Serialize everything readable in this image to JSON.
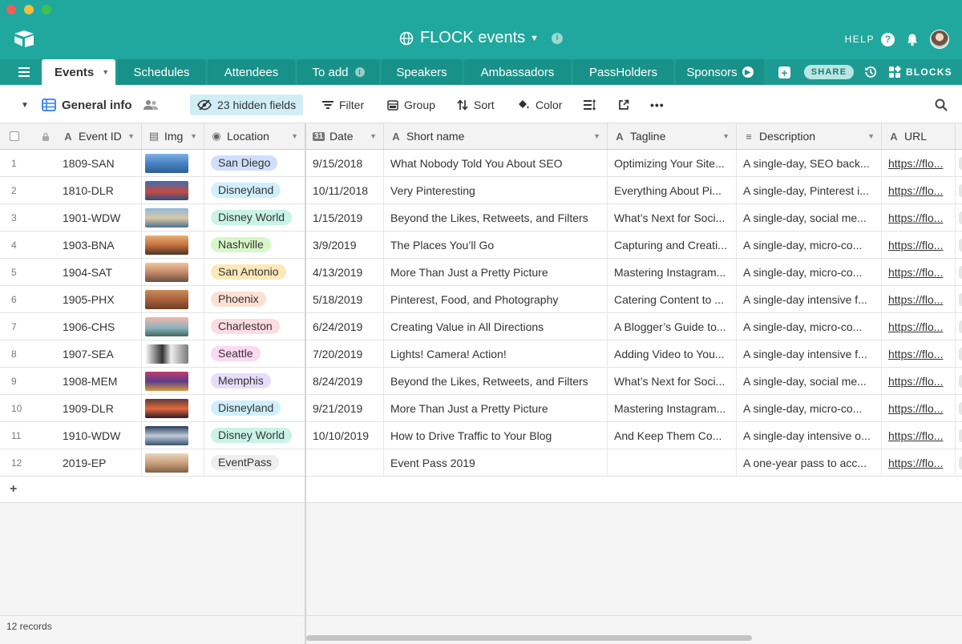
{
  "window": {
    "title": "FLOCK events"
  },
  "header": {
    "help_label": "HELP"
  },
  "tabs": [
    {
      "label": "Events",
      "active": true
    },
    {
      "label": "Schedules"
    },
    {
      "label": "Attendees"
    },
    {
      "label": "To add"
    },
    {
      "label": "Speakers"
    },
    {
      "label": "Ambassadors"
    },
    {
      "label": "PassHolders"
    },
    {
      "label": "Sponsors"
    }
  ],
  "actions": {
    "share_label": "SHARE",
    "blocks_label": "BLOCKS"
  },
  "toolbar": {
    "view_name": "General info",
    "hidden_fields_label": "23 hidden fields",
    "filter_label": "Filter",
    "group_label": "Group",
    "sort_label": "Sort",
    "color_label": "Color"
  },
  "columns": {
    "event_id": "Event ID",
    "img": "Img",
    "location": "Location",
    "date": "Date",
    "short_name": "Short name",
    "tagline": "Tagline",
    "description": "Description",
    "url": "URL"
  },
  "rows": [
    {
      "num": "1",
      "event_id": "1809-SAN",
      "location": "San Diego",
      "date": "9/15/2018",
      "short_name": "What Nobody Told You About SEO",
      "tagline": "Optimizing Your Site...",
      "description": "A single-day, SEO back...",
      "url": "https://flo..."
    },
    {
      "num": "2",
      "event_id": "1810-DLR",
      "location": "Disneyland",
      "date": "10/11/2018",
      "short_name": "Very Pinteresting",
      "tagline": "Everything About Pi...",
      "description": "A single-day, Pinterest i...",
      "url": "https://flo..."
    },
    {
      "num": "3",
      "event_id": "1901-WDW",
      "location": "Disney World",
      "date": "1/15/2019",
      "short_name": "Beyond the Likes, Retweets, and Filters",
      "tagline": "What’s Next for Soci...",
      "description": "A single-day, social me...",
      "url": "https://flo..."
    },
    {
      "num": "4",
      "event_id": "1903-BNA",
      "location": "Nashville",
      "date": "3/9/2019",
      "short_name": "The Places You’ll Go",
      "tagline": "Capturing and Creati...",
      "description": "A single-day, micro-co...",
      "url": "https://flo..."
    },
    {
      "num": "5",
      "event_id": "1904-SAT",
      "location": "San Antonio",
      "date": "4/13/2019",
      "short_name": "More Than Just a Pretty Picture",
      "tagline": "Mastering Instagram...",
      "description": "A single-day, micro-co...",
      "url": "https://flo..."
    },
    {
      "num": "6",
      "event_id": "1905-PHX",
      "location": "Phoenix",
      "date": "5/18/2019",
      "short_name": "Pinterest, Food, and Photography",
      "tagline": "Catering Content to ...",
      "description": "A single-day intensive f...",
      "url": "https://flo..."
    },
    {
      "num": "7",
      "event_id": "1906-CHS",
      "location": "Charleston",
      "date": "6/24/2019",
      "short_name": "Creating Value in All Directions",
      "tagline": "A Blogger’s Guide to...",
      "description": "A single-day, micro-co...",
      "url": "https://flo..."
    },
    {
      "num": "8",
      "event_id": "1907-SEA",
      "location": "Seattle",
      "date": "7/20/2019",
      "short_name": "Lights! Camera! Action!",
      "tagline": "Adding Video to You...",
      "description": "A single-day intensive f...",
      "url": "https://flo..."
    },
    {
      "num": "9",
      "event_id": "1908-MEM",
      "location": "Memphis",
      "date": "8/24/2019",
      "short_name": "Beyond the Likes, Retweets, and Filters",
      "tagline": "What’s Next for Soci...",
      "description": "A single-day, social me...",
      "url": "https://flo..."
    },
    {
      "num": "10",
      "event_id": "1909-DLR",
      "location": "Disneyland",
      "date": "9/21/2019",
      "short_name": "More Than Just a Pretty Picture",
      "tagline": "Mastering Instagram...",
      "description": "A single-day, micro-co...",
      "url": "https://flo..."
    },
    {
      "num": "11",
      "event_id": "1910-WDW",
      "location": "Disney World",
      "date": "10/10/2019",
      "short_name": "How to Drive Traffic to Your Blog",
      "tagline": "And Keep Them Co...",
      "description": "A single-day intensive o...",
      "url": "https://flo..."
    },
    {
      "num": "12",
      "event_id": "2019-EP",
      "location": "EventPass",
      "date": "",
      "short_name": "Event Pass 2019",
      "tagline": "",
      "description": "A one-year pass to acc...",
      "url": "https://flo..."
    }
  ],
  "footer": {
    "records_label": "12 records"
  },
  "colors": {
    "brand_teal": "#20a89e",
    "tab_bar": "#1d9b92",
    "hidden_fields_bg": "#d1eef7",
    "location_pills": {
      "San Diego": "#cfdffb",
      "Disneyland": "#d0effc",
      "Disney World": "#c9f3e6",
      "Nashville": "#d7f7c8",
      "San Antonio": "#fde8b8",
      "Phoenix": "#fde0d2",
      "Charleston": "#fcdbe3",
      "Seattle": "#fcd9f2",
      "Memphis": "#e8dcfb",
      "EventPass": "#eeeeee"
    }
  },
  "icons": {
    "logo": "airtable-box-icon",
    "title": "globe-icon",
    "help": "question-circle-icon",
    "notifications": "bell-icon",
    "history": "history-clock-icon",
    "blocks": "blocks-grid-icon",
    "search": "search-icon"
  }
}
